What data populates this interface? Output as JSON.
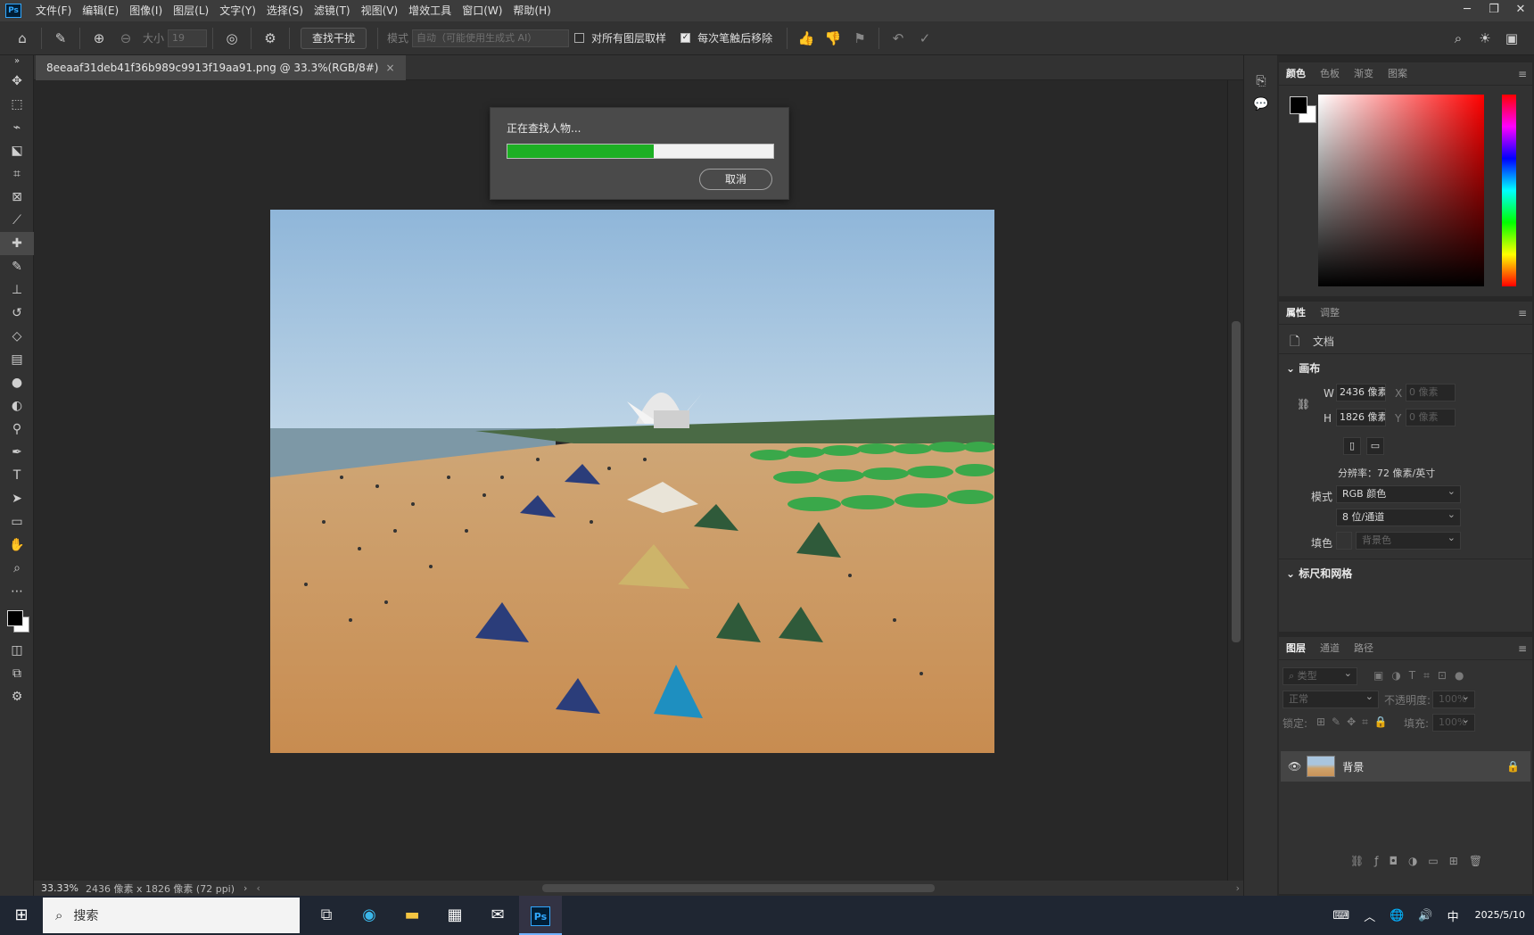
{
  "app": {
    "logo": "Ps"
  },
  "menu": [
    "文件(F)",
    "编辑(E)",
    "图像(I)",
    "图层(L)",
    "文字(Y)",
    "选择(S)",
    "滤镜(T)",
    "视图(V)",
    "增效工具",
    "窗口(W)",
    "帮助(H)"
  ],
  "options": {
    "size_label": "大小",
    "size_value": "19",
    "find_distraction": "查找干扰",
    "mode_label": "模式",
    "mode_value": "自动（可能使用生成式 AI）",
    "sample_all": "对所有图层取样",
    "remove_after_stroke": "每次笔触后移除",
    "sample_all_checked": false,
    "remove_after_stroke_checked": true
  },
  "document": {
    "tab_title": "8eeaaf31deb41f36b989c9913f19aa91.png @ 33.3%(RGB/8#)",
    "close": "×"
  },
  "dialog": {
    "message": "正在查找人物...",
    "progress": 0.55,
    "cancel": "取消",
    "fill_color": "#1db024"
  },
  "status": {
    "zoom": "33.33%",
    "info": "2436 像素 x 1826 像素 (72 ppi)"
  },
  "color_panel": {
    "tabs": [
      "颜色",
      "色板",
      "渐变",
      "图案"
    ],
    "foreground": "#000000",
    "background": "#ffffff"
  },
  "properties_panel": {
    "tabs": [
      "属性",
      "调整"
    ],
    "doc_label": "文档",
    "canvas_section": "画布",
    "w_label": "W",
    "w_value": "2436 像素",
    "h_label": "H",
    "h_value": "1826 像素",
    "x_label": "X",
    "x_value": "0 像素",
    "y_label": "Y",
    "y_value": "0 像素",
    "resolution": "分辨率：72 像素/英寸",
    "mode_label": "模式",
    "mode_value": "RGB 颜色",
    "depth_value": "8 位/通道",
    "fill_label": "填色",
    "fill_value": "背景色",
    "rulers_section": "标尺和网格"
  },
  "layers_panel": {
    "tabs": [
      "图层",
      "通道",
      "路径"
    ],
    "filter_placeholder": "类型",
    "blend_mode": "正常",
    "opacity_label": "不透明度:",
    "opacity_value": "100%",
    "lock_label": "锁定:",
    "fill_label": "填充:",
    "fill_value": "100%",
    "layer_name": "背景"
  },
  "taskbar": {
    "search": "搜索",
    "ime": "中",
    "date": "2025/5/10"
  }
}
